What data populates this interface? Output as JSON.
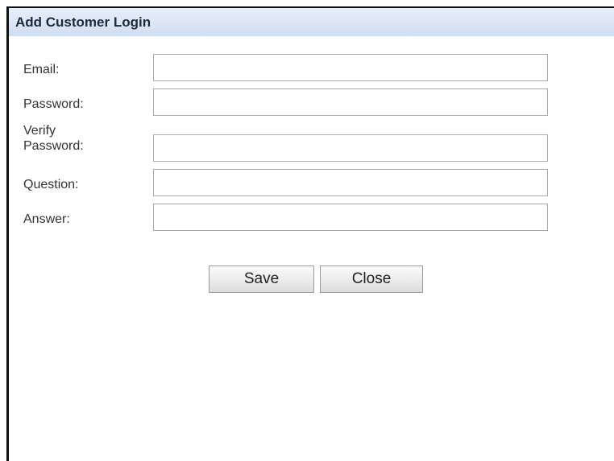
{
  "dialog": {
    "title": "Add Customer Login"
  },
  "form": {
    "email_label": "Email:",
    "email_value": "",
    "password_label": "Password:",
    "password_value": "",
    "verify_label_line1": "Verify",
    "verify_label_line2": "Password:",
    "verify_value": "",
    "question_label": "Question:",
    "question_value": "",
    "answer_label": "Answer:",
    "answer_value": ""
  },
  "buttons": {
    "save_label": "Save",
    "close_label": "Close"
  }
}
